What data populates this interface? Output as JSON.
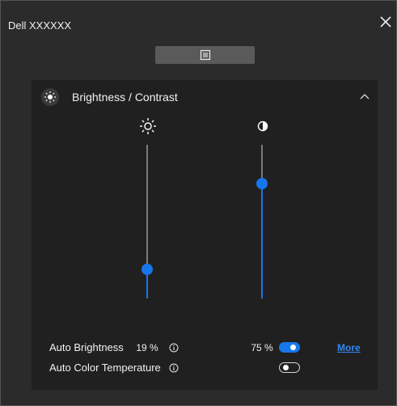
{
  "app": {
    "title": "Dell XXXXXX"
  },
  "panel": {
    "title": "Brightness / Contrast"
  },
  "sliders": {
    "brightness": {
      "value_label": "19 %",
      "value": 19
    },
    "contrast": {
      "value_label": "75 %",
      "value": 75
    }
  },
  "settings": {
    "auto_brightness": {
      "label": "Auto Brightness",
      "enabled": true,
      "link": "More"
    },
    "auto_color_temp": {
      "label": "Auto Color Temperature",
      "enabled": false
    }
  },
  "colors": {
    "accent": "#1677ea",
    "link": "#2f8af3",
    "panel_bg": "#202020",
    "window_bg": "#2b2b2b"
  },
  "icons": [
    "close-icon",
    "menu-list-icon",
    "brightness-icon",
    "sun-icon",
    "contrast-icon",
    "chevron-up-icon",
    "info-icon"
  ]
}
